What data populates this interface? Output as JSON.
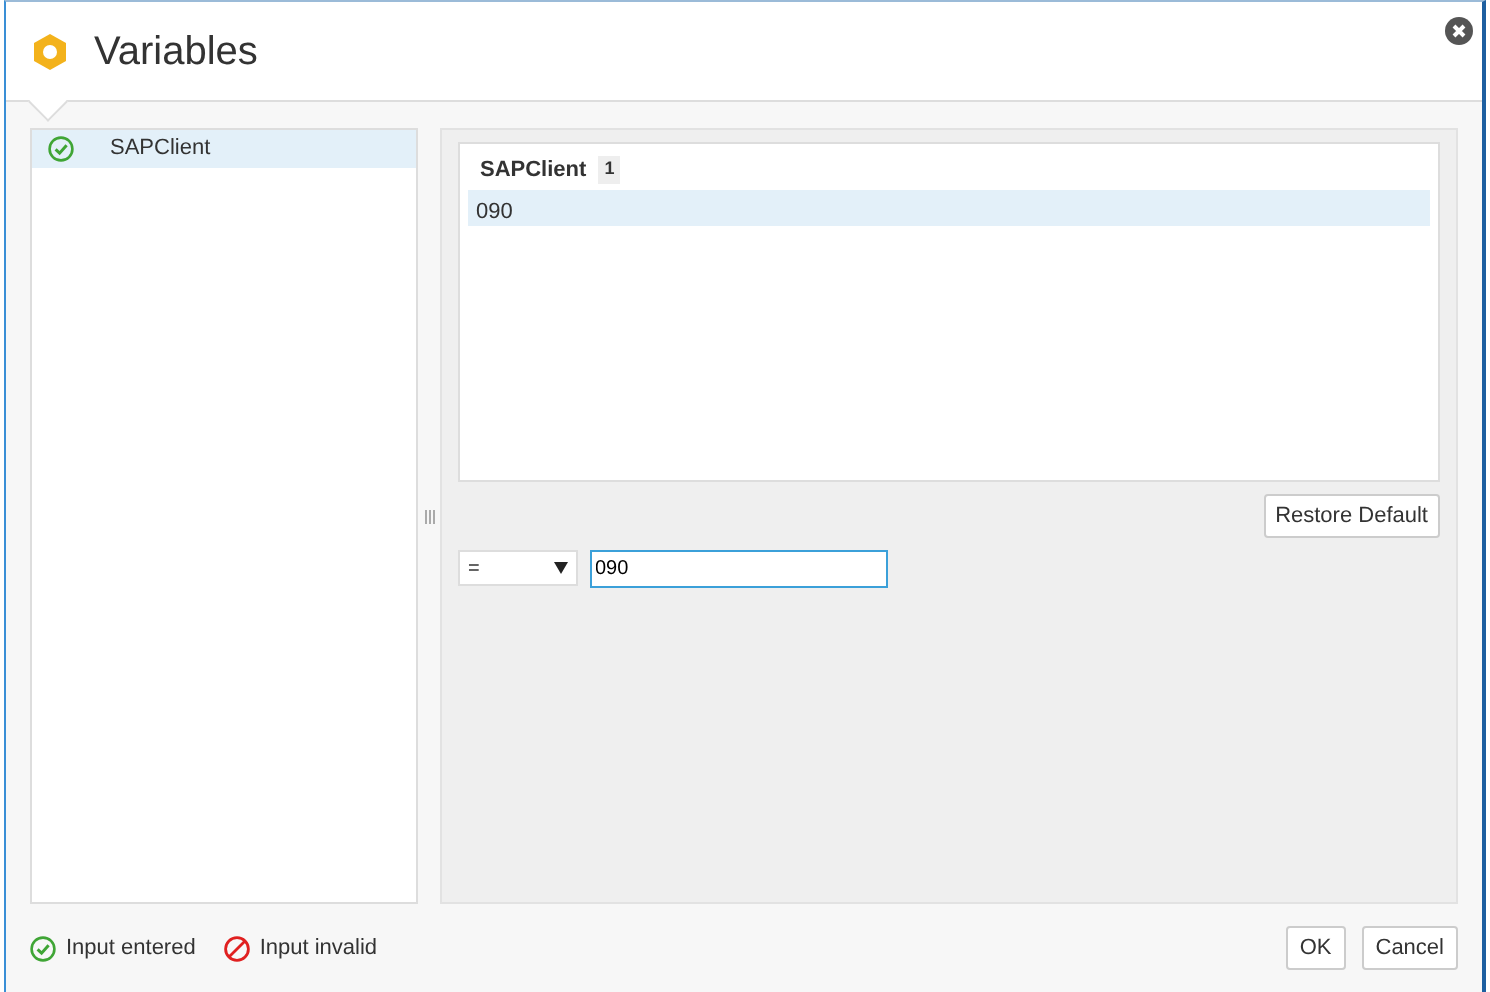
{
  "window": {
    "title": "Variables"
  },
  "variables": [
    {
      "name": "SAPClient",
      "entered": true,
      "selected": true
    }
  ],
  "values": {
    "title": "SAPClient",
    "count": "1",
    "rows": [
      {
        "value": "090",
        "selected": true
      }
    ]
  },
  "restore_button": "Restore Default",
  "filter": {
    "operator": "=",
    "value": "090"
  },
  "legend": [
    {
      "kind": "entered",
      "label": "Input entered"
    },
    {
      "kind": "invalid",
      "label": "Input invalid"
    }
  ],
  "buttons": [
    "OK",
    "Cancel"
  ]
}
